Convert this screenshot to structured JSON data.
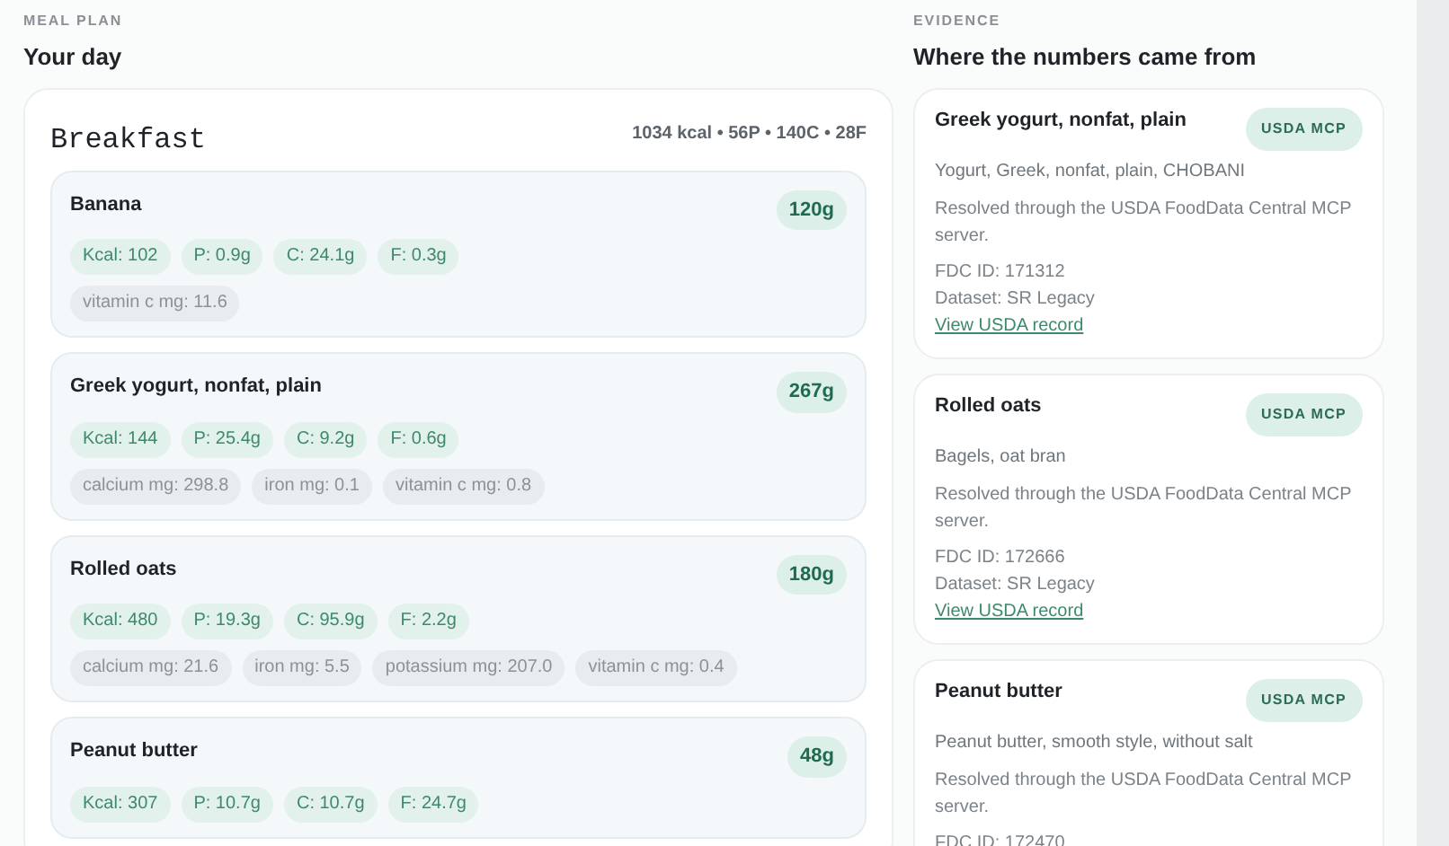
{
  "meal_plan": {
    "eyebrow": "MEAL PLAN",
    "title": "Your day",
    "meals": [
      {
        "name": "Breakfast",
        "summary": "1034 kcal • 56P • 140C • 28F",
        "foods": [
          {
            "name": "Banana",
            "amount": "120g",
            "macros": [
              "Kcal: 102",
              "P: 0.9g",
              "C: 24.1g",
              "F: 0.3g"
            ],
            "micros": [
              "vitamin c mg: 11.6"
            ]
          },
          {
            "name": "Greek yogurt, nonfat, plain",
            "amount": "267g",
            "macros": [
              "Kcal: 144",
              "P: 25.4g",
              "C: 9.2g",
              "F: 0.6g"
            ],
            "micros": [
              "calcium mg: 298.8",
              "iron mg: 0.1",
              "vitamin c mg: 0.8"
            ]
          },
          {
            "name": "Rolled oats",
            "amount": "180g",
            "macros": [
              "Kcal: 480",
              "P: 19.3g",
              "C: 95.9g",
              "F: 2.2g"
            ],
            "micros": [
              "calcium mg: 21.6",
              "iron mg: 5.5",
              "potassium mg: 207.0",
              "vitamin c mg: 0.4"
            ]
          },
          {
            "name": "Peanut butter",
            "amount": "48g",
            "macros": [
              "Kcal: 307",
              "P: 10.7g",
              "C: 10.7g",
              "F: 24.7g"
            ]
          }
        ]
      }
    ]
  },
  "evidence": {
    "eyebrow": "EVIDENCE",
    "title": "Where the numbers came from",
    "items": [
      {
        "name": "Greek yogurt, nonfat, plain",
        "badge": "USDA MCP",
        "match": "Yogurt, Greek, nonfat, plain, CHOBANI",
        "note": "Resolved through the USDA FoodData Central MCP server.",
        "fdc_id": "FDC ID: 171312",
        "dataset": "Dataset: SR Legacy",
        "link": "View USDA record"
      },
      {
        "name": "Rolled oats",
        "badge": "USDA MCP",
        "match": "Bagels, oat bran",
        "note": "Resolved through the USDA FoodData Central MCP server.",
        "fdc_id": "FDC ID: 172666",
        "dataset": "Dataset: SR Legacy",
        "link": "View USDA record"
      },
      {
        "name": "Peanut butter",
        "badge": "USDA MCP",
        "match": "Peanut butter, smooth style, without salt",
        "note": "Resolved through the USDA FoodData Central MCP server.",
        "fdc_id": "FDC ID: 172470"
      }
    ]
  }
}
